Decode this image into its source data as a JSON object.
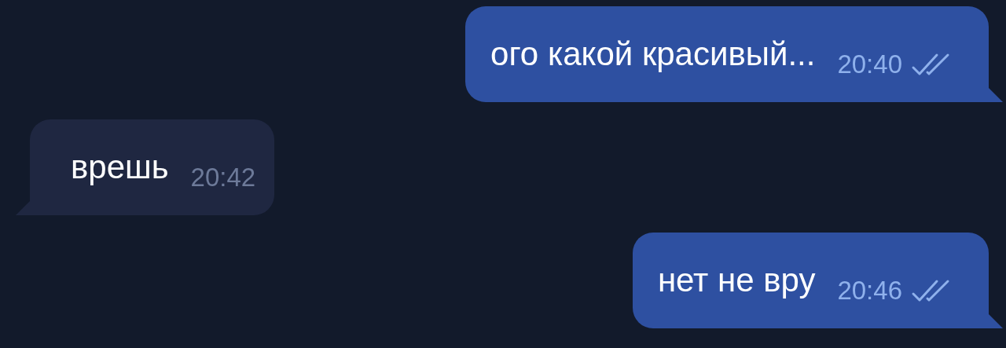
{
  "messages": [
    {
      "kind": "outgoing",
      "text": "ого какой красивый...",
      "time": "20:40",
      "read": true
    },
    {
      "kind": "incoming",
      "text": "врешь",
      "time": "20:42"
    },
    {
      "kind": "outgoing",
      "text": "нет не вру",
      "time": "20:46",
      "read": true
    }
  ]
}
